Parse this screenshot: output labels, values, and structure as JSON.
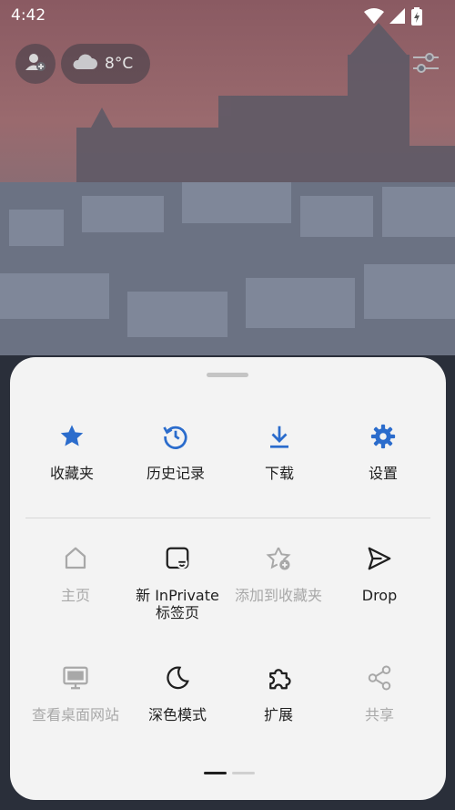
{
  "status_bar": {
    "time": "4:42"
  },
  "top_chips": {
    "weather_temp": "8°C"
  },
  "menu": {
    "row1": [
      {
        "label": "收藏夹",
        "icon": "star-icon"
      },
      {
        "label": "历史记录",
        "icon": "history-icon"
      },
      {
        "label": "下载",
        "icon": "download-icon"
      },
      {
        "label": "设置",
        "icon": "gear-icon"
      }
    ],
    "row2": [
      {
        "label": "主页",
        "icon": "home-icon",
        "enabled": false
      },
      {
        "label": "新 InPrivate 标签页",
        "icon": "inprivate-tab-icon",
        "enabled": true
      },
      {
        "label": "添加到收藏夹",
        "icon": "star-add-icon",
        "enabled": false
      },
      {
        "label": "Drop",
        "icon": "send-icon",
        "enabled": true
      }
    ],
    "row3": [
      {
        "label": "查看桌面网站",
        "icon": "desktop-icon",
        "enabled": false
      },
      {
        "label": "深色模式",
        "icon": "moon-icon",
        "enabled": true
      },
      {
        "label": "扩展",
        "icon": "puzzle-icon",
        "enabled": true
      },
      {
        "label": "共享",
        "icon": "share-icon",
        "enabled": false
      }
    ],
    "pager": {
      "pages": 2,
      "current": 1
    }
  },
  "colors": {
    "accent": "#2b6ccc",
    "sheet_bg": "#f3f3f3",
    "disabled": "#a8a8a8"
  }
}
